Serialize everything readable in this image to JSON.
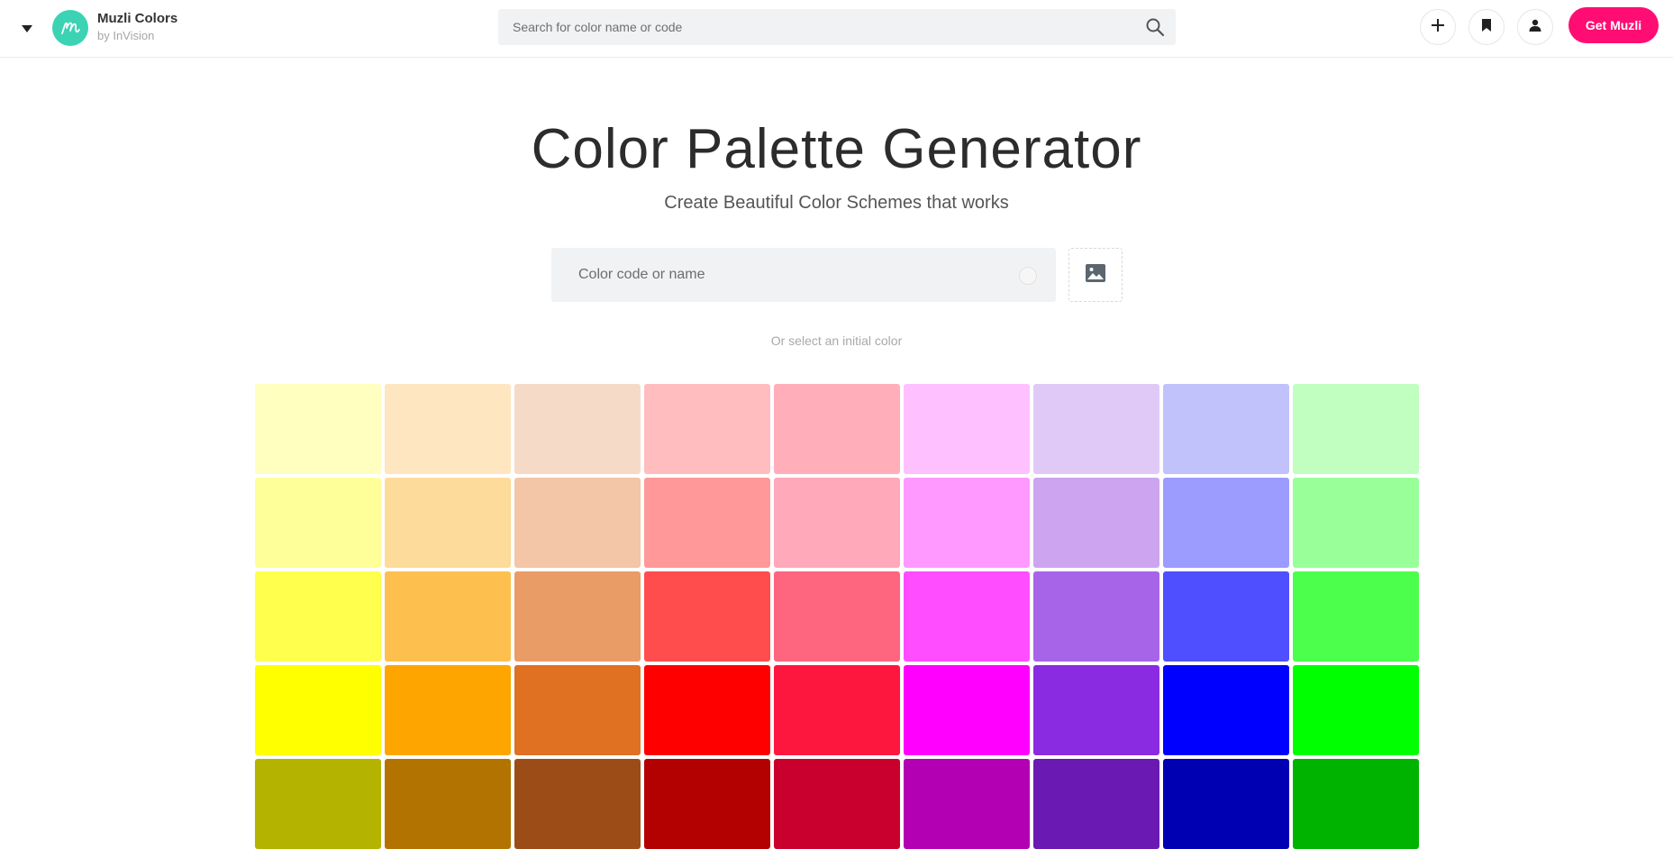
{
  "header": {
    "brand_name": "Muzli Colors",
    "brand_sub": "by InVision",
    "search_placeholder": "Search for color name or code",
    "cta_label": "Get Muzli",
    "cta_color": "#ff0d73",
    "logo_color": "#3cd3b4",
    "icons": [
      "menu-caret-icon",
      "muzli-logo-icon",
      "search-icon",
      "plus-icon",
      "bookmark-icon",
      "user-icon"
    ]
  },
  "hero": {
    "title": "Color Palette Generator",
    "subtitle": "Create Beautiful Color Schemes that works",
    "input_placeholder": "Color code or name",
    "image_icon": "image-icon",
    "select_hint": "Or select an initial color"
  },
  "color_grid": {
    "rows": [
      [
        "#ffffc0",
        "#fee6c0",
        "#f5dbc7",
        "#ffbdc0",
        "#ffaeba",
        "#ffc0ff",
        "#e0c9f7",
        "#c1c1fc",
        "#c0ffc0"
      ],
      [
        "#ffff99",
        "#fddb9a",
        "#f2c6a6",
        "#ff9899",
        "#ffa9ba",
        "#ff99ff",
        "#cca4f0",
        "#9c9cfe",
        "#99ff99"
      ],
      [
        "#ffff4d",
        "#fdc04f",
        "#ea9c67",
        "#ff4d4e",
        "#fe657e",
        "#ff4dff",
        "#a764e8",
        "#4f4fff",
        "#4dff4d"
      ],
      [
        "#ffff00",
        "#ffa500",
        "#e07022",
        "#ff0000",
        "#fd173f",
        "#ff00ff",
        "#8a2be2",
        "#0000ff",
        "#00ff00"
      ],
      [
        "#b3b300",
        "#b37300",
        "#9c4d17",
        "#b30000",
        "#c9002d",
        "#b300b3",
        "#6a19b3",
        "#0000b3",
        "#00b300"
      ]
    ]
  }
}
